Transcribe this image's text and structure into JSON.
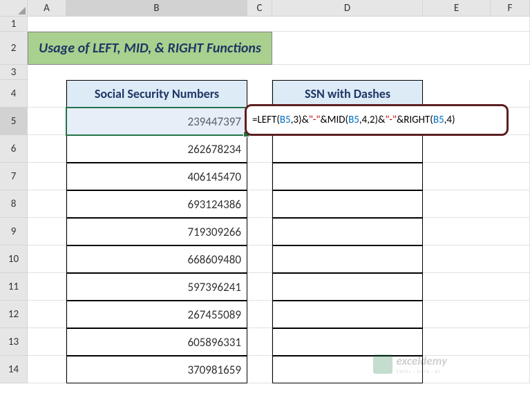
{
  "columns": [
    "A",
    "B",
    "C",
    "D",
    "E",
    "F"
  ],
  "rows": [
    "1",
    "2",
    "3",
    "4",
    "5",
    "6",
    "7",
    "8",
    "9",
    "10",
    "11",
    "12",
    "13",
    "14"
  ],
  "title": "Usage of LEFT, MID, & RIGHT Functions",
  "headers": {
    "ssn": "Social Security Numbers",
    "dashes": "SSN with Dashes"
  },
  "data": {
    "ssn_values": [
      "239447397",
      "262678234",
      "406145470",
      "693124386",
      "719309266",
      "668609480",
      "597396241",
      "267455089",
      "605896331",
      "370981659"
    ]
  },
  "formula": {
    "eq": "=",
    "left": "LEFT",
    "lparen": "(",
    "ref1": "B5",
    "c1": ",3",
    "rparen": ")",
    "amp": "&",
    "dash": "\"-\"",
    "mid": "MID",
    "ref2": "B5",
    "c2": ",4,2",
    "right": "RIGHT",
    "ref3": "B5",
    "c3": ",4"
  },
  "watermark": {
    "main": "exceldemy",
    "sub": "EXCEL · DATA · BI"
  }
}
